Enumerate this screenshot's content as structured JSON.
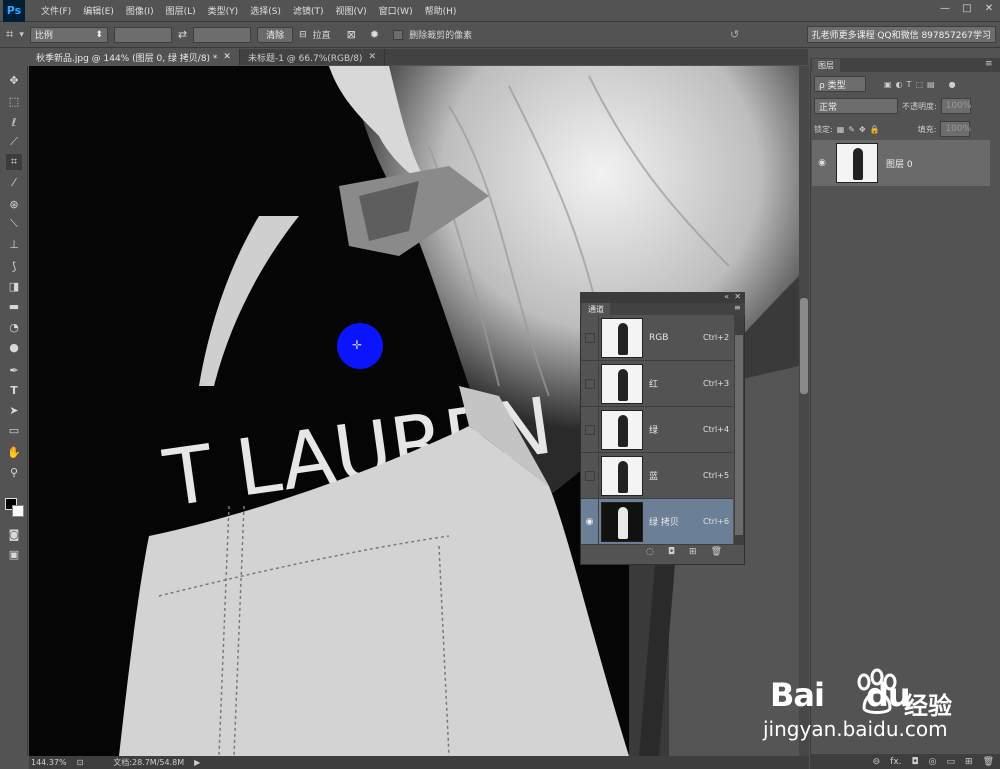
{
  "app": {
    "logo": "Ps",
    "menus": [
      "文件(F)",
      "编辑(E)",
      "图像(I)",
      "图层(L)",
      "类型(Y)",
      "选择(S)",
      "滤镜(T)",
      "视图(V)",
      "窗口(W)",
      "帮助(H)"
    ],
    "window_controls": [
      "—",
      "□",
      "✕"
    ]
  },
  "options_bar": {
    "ratio_select": "比例",
    "clear_button": "清除",
    "straighten_label": "拉直",
    "delete_cropped_label": "删除裁剪的像素",
    "workspace_text": "孔老师更多课程 QQ和微信 897857267学习"
  },
  "tabs": [
    {
      "label": "秋季新品.jpg @ 144% (图层 0, 绿 拷贝/8) *",
      "close": "✕"
    },
    {
      "label": "未标题-1 @ 66.7%(RGB/8)",
      "close": "✕"
    }
  ],
  "canvas": {
    "print_text": "T LAUREN"
  },
  "status": {
    "zoom": "144.37%",
    "doc": "文档:28.7M/54.8M"
  },
  "layers_panel": {
    "tab": "图层",
    "filter": "ρ 类型",
    "blend_mode": "正常",
    "opacity_label": "不透明度:",
    "opacity_value": "100%",
    "lock_label": "锁定:",
    "fill_label": "填充:",
    "fill_value": "100%",
    "layer_name": "图层 0",
    "bottom_icons": [
      "⊖",
      "fx.",
      "◘",
      "◎",
      "▭",
      "⊞",
      "🗑"
    ]
  },
  "channels_panel": {
    "tab": "通道",
    "channels": [
      {
        "name": "RGB",
        "shortcut": "Ctrl+2",
        "selected": false
      },
      {
        "name": "红",
        "shortcut": "Ctrl+3",
        "selected": false
      },
      {
        "name": "绿",
        "shortcut": "Ctrl+4",
        "selected": false
      },
      {
        "name": "蓝",
        "shortcut": "Ctrl+5",
        "selected": false
      },
      {
        "name": "绿 拷贝",
        "shortcut": "Ctrl+6",
        "selected": true
      }
    ]
  },
  "watermark": {
    "brand": "Bai",
    "brand2": "du",
    "jingyan": "经验",
    "url": "jingyan.baidu.com"
  },
  "colors": {
    "brush_cursor": "#0a14ff",
    "selected_channel": "#6b7f96",
    "background": "#535353"
  }
}
